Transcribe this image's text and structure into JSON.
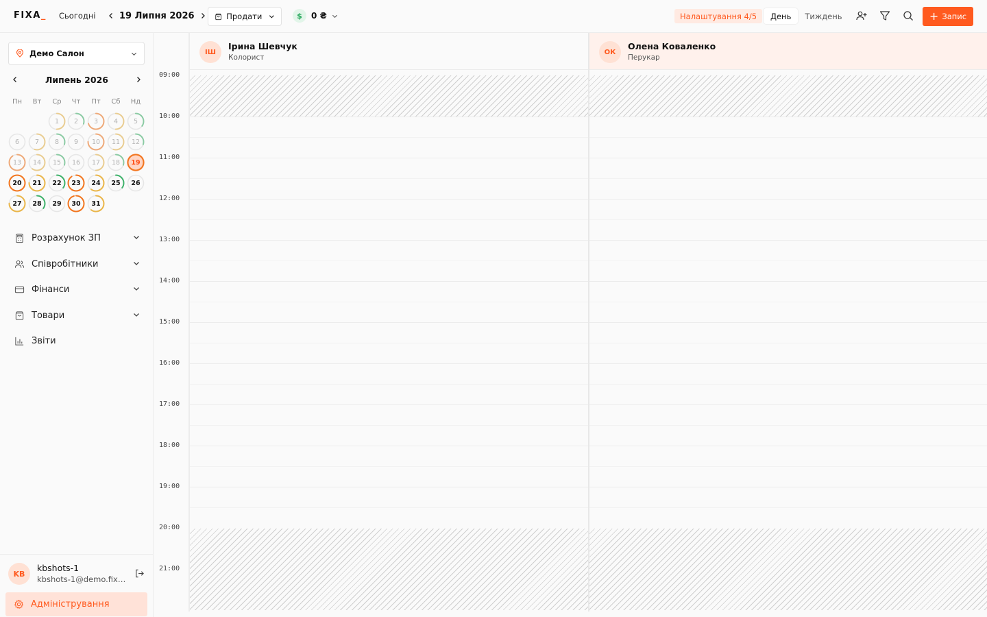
{
  "app": {
    "logo": "FIXA",
    "logo_accent_letter": "I"
  },
  "header": {
    "today_label": "Сьогодні",
    "date_label": "19 Липня 2026",
    "sell_label": "Продати",
    "money_symbol": "$",
    "money_amount": "0 ₴",
    "settings_badge": "Налаштування 4/5",
    "view_day": "День",
    "view_week": "Тиждень",
    "active_view": "День",
    "add_label": "Запис",
    "accent_color": "#ff5a1f"
  },
  "sidebar": {
    "salon_name": "Демо Салон",
    "calendar_title": "Липень 2026",
    "weekdays": [
      "Пн",
      "Вт",
      "Ср",
      "Чт",
      "Пт",
      "Сб",
      "Нд"
    ],
    "days": [
      {
        "n": 1,
        "load": 0.5,
        "tone": "yellow"
      },
      {
        "n": 2,
        "load": 0.3,
        "tone": "green"
      },
      {
        "n": 3,
        "load": 0.7,
        "tone": "orange"
      },
      {
        "n": 4,
        "load": 0.5,
        "tone": "yellow"
      },
      {
        "n": 5,
        "load": 0.35,
        "tone": "green"
      },
      {
        "n": 6,
        "load": 0,
        "tone": "none"
      },
      {
        "n": 7,
        "load": 0.55,
        "tone": "yellow"
      },
      {
        "n": 8,
        "load": 0.3,
        "tone": "green"
      },
      {
        "n": 9,
        "load": 0,
        "tone": "none"
      },
      {
        "n": 10,
        "load": 0.75,
        "tone": "orange"
      },
      {
        "n": 11,
        "load": 0.55,
        "tone": "yellow"
      },
      {
        "n": 12,
        "load": 0.3,
        "tone": "green"
      },
      {
        "n": 13,
        "load": 0.9,
        "tone": "orange"
      },
      {
        "n": 14,
        "load": 0.6,
        "tone": "yellow"
      },
      {
        "n": 15,
        "load": 0.3,
        "tone": "green"
      },
      {
        "n": 16,
        "load": 0,
        "tone": "none"
      },
      {
        "n": 17,
        "load": 0.5,
        "tone": "yellow"
      },
      {
        "n": 18,
        "load": 0.3,
        "tone": "green"
      },
      {
        "n": 19,
        "load": 1,
        "tone": "orange"
      },
      {
        "n": 20,
        "load": 1,
        "tone": "orange"
      },
      {
        "n": 21,
        "load": 0.75,
        "tone": "yellow"
      },
      {
        "n": 22,
        "load": 0.35,
        "tone": "green"
      },
      {
        "n": 23,
        "load": 0.9,
        "tone": "orange"
      },
      {
        "n": 24,
        "load": 0.6,
        "tone": "yellow"
      },
      {
        "n": 25,
        "load": 0.35,
        "tone": "green"
      },
      {
        "n": 26,
        "load": 0,
        "tone": "none"
      },
      {
        "n": 27,
        "load": 0.75,
        "tone": "yellow"
      },
      {
        "n": 28,
        "load": 0.35,
        "tone": "green"
      },
      {
        "n": 29,
        "load": 0,
        "tone": "none"
      },
      {
        "n": 30,
        "load": 0.95,
        "tone": "orange"
      },
      {
        "n": 31,
        "load": 0.6,
        "tone": "yellow"
      }
    ],
    "first_weekday_index": 2,
    "today": 19,
    "menu": [
      {
        "label": "Розрахунок ЗП",
        "icon": "calculator-icon",
        "has_chevron": true
      },
      {
        "label": "Співробітники",
        "icon": "users-icon",
        "has_chevron": true
      },
      {
        "label": "Фінанси",
        "icon": "card-icon",
        "has_chevron": true
      },
      {
        "label": "Товари",
        "icon": "bag-icon",
        "has_chevron": true
      },
      {
        "label": "Звіти",
        "icon": "chart-icon",
        "has_chevron": false
      }
    ],
    "user": {
      "initials": "KB",
      "name": "kbshots-1",
      "email": "kbshots-1@demo.fixa.app"
    },
    "admin_label": "Адміністрування"
  },
  "schedule": {
    "hours": [
      "09:00",
      "10:00",
      "11:00",
      "12:00",
      "13:00",
      "14:00",
      "15:00",
      "16:00",
      "17:00",
      "18:00",
      "19:00",
      "20:00",
      "21:00"
    ],
    "staff": [
      {
        "initials": "ІШ",
        "name": "Ірина Шевчук",
        "role": "Колорист",
        "highlight": false
      },
      {
        "initials": "ОК",
        "name": "Олена Коваленко",
        "role": "Перукар",
        "highlight": true
      }
    ],
    "working_from": "10:00",
    "working_to": "20:00"
  }
}
